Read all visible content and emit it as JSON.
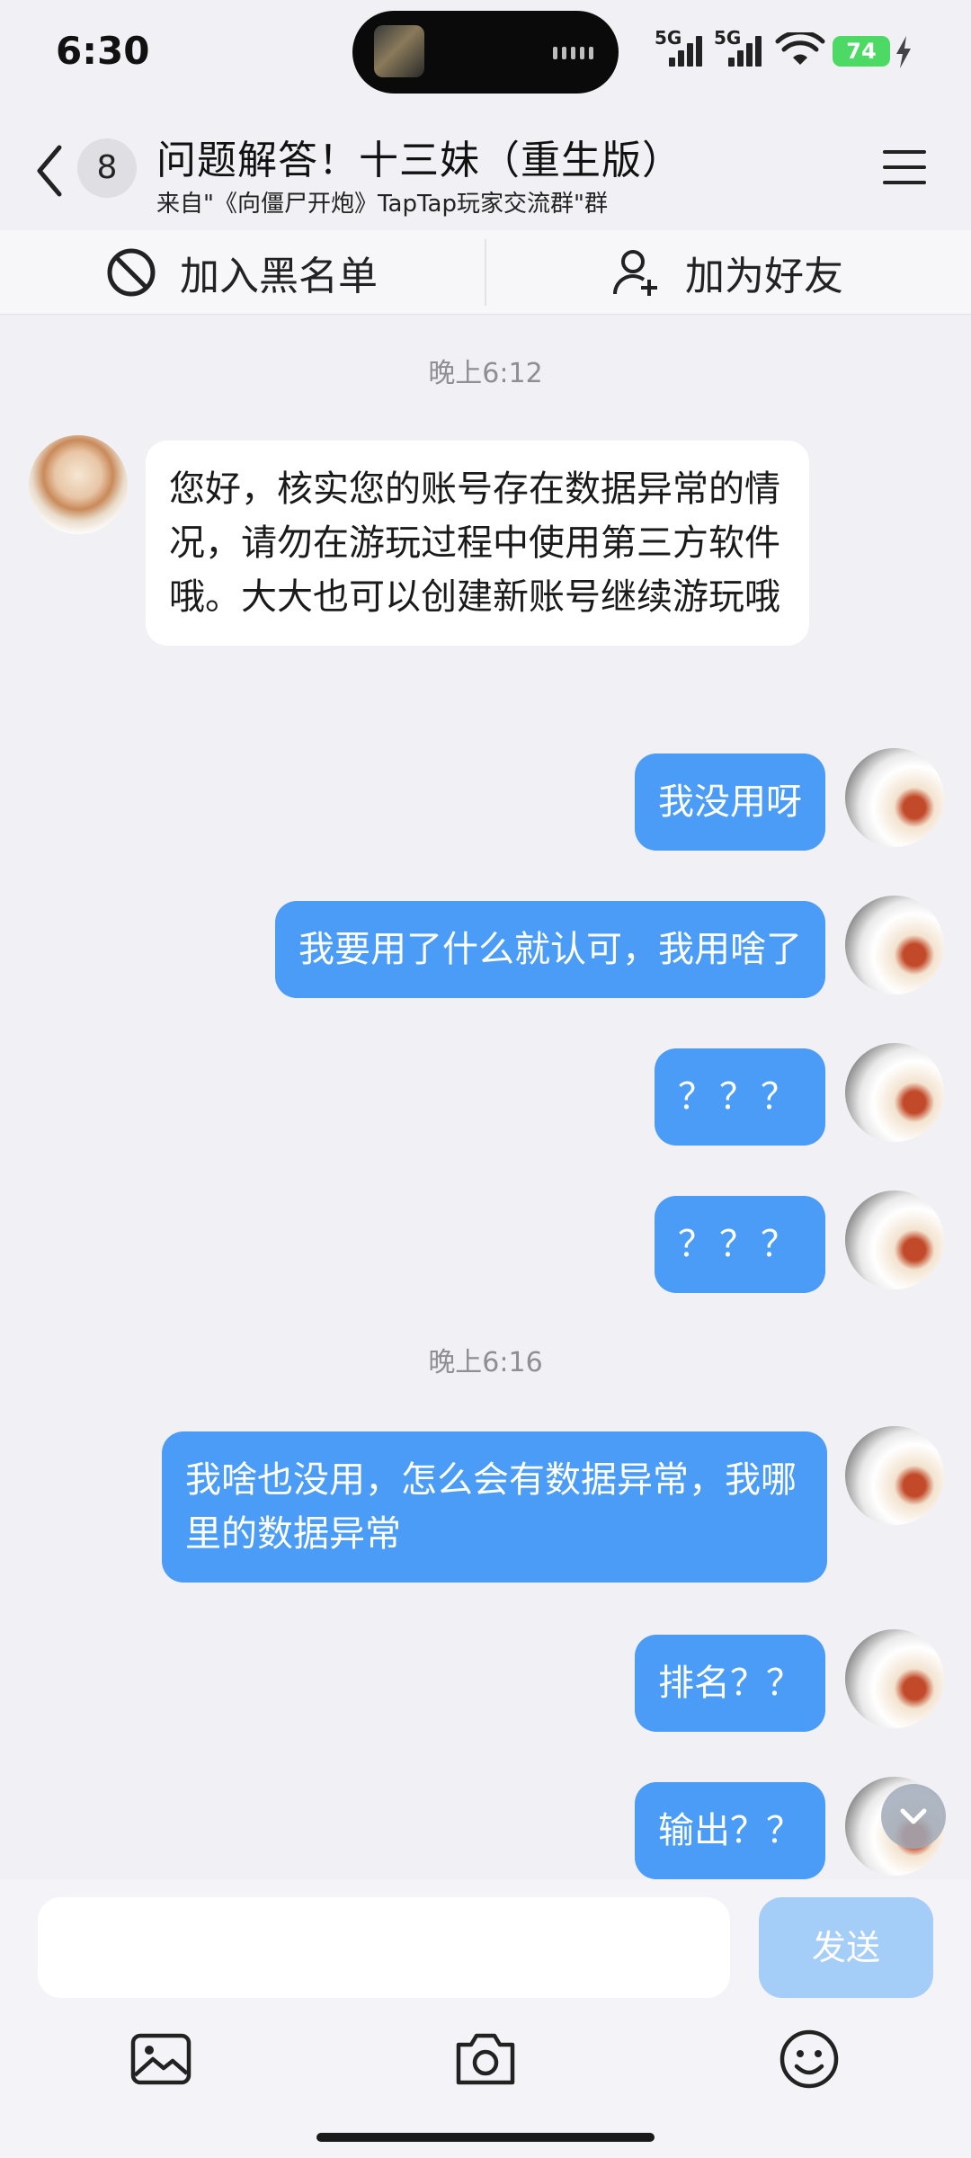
{
  "status_bar": {
    "time": "6:30",
    "network_1": "5G",
    "network_2": "5G",
    "battery": "74"
  },
  "header": {
    "unread_count": "8",
    "title": "问题解答！十三妹（重生版）",
    "subtitle": "来自\"《向僵尸开炮》TapTap玩家交流群\"群"
  },
  "actions": {
    "block_label": "加入黑名单",
    "add_friend_label": "加为好友"
  },
  "messages": [
    {
      "type": "time",
      "text": "晚上6:12"
    },
    {
      "type": "incoming",
      "text": "您好，核实您的账号存在数据异常的情况，请勿在游玩过程中使用第三方软件哦。大大也可以创建新账号继续游玩哦"
    },
    {
      "type": "outgoing",
      "text": "我没用呀"
    },
    {
      "type": "outgoing",
      "text": "我要用了什么就认可，我用啥了"
    },
    {
      "type": "outgoing",
      "text": "？？？"
    },
    {
      "type": "outgoing",
      "text": "？？？"
    },
    {
      "type": "time",
      "text": "晚上6:16"
    },
    {
      "type": "outgoing",
      "text": "我啥也没用，怎么会有数据异常，我哪里的数据异常"
    },
    {
      "type": "outgoing",
      "text": "排名？？"
    },
    {
      "type": "outgoing",
      "text": "输出？？"
    }
  ],
  "composer": {
    "input_value": "",
    "send_label": "发送"
  },
  "icons": [
    "back-icon",
    "menu-icon",
    "block-icon",
    "add-friend-icon",
    "scroll-down-icon",
    "image-icon",
    "camera-icon",
    "emoji-icon"
  ],
  "colors": {
    "outgoing_bubble": "#4a9cf7",
    "send_button_disabled": "#a4cdf7",
    "battery": "#4cd964",
    "background": "#f0f0f5"
  }
}
